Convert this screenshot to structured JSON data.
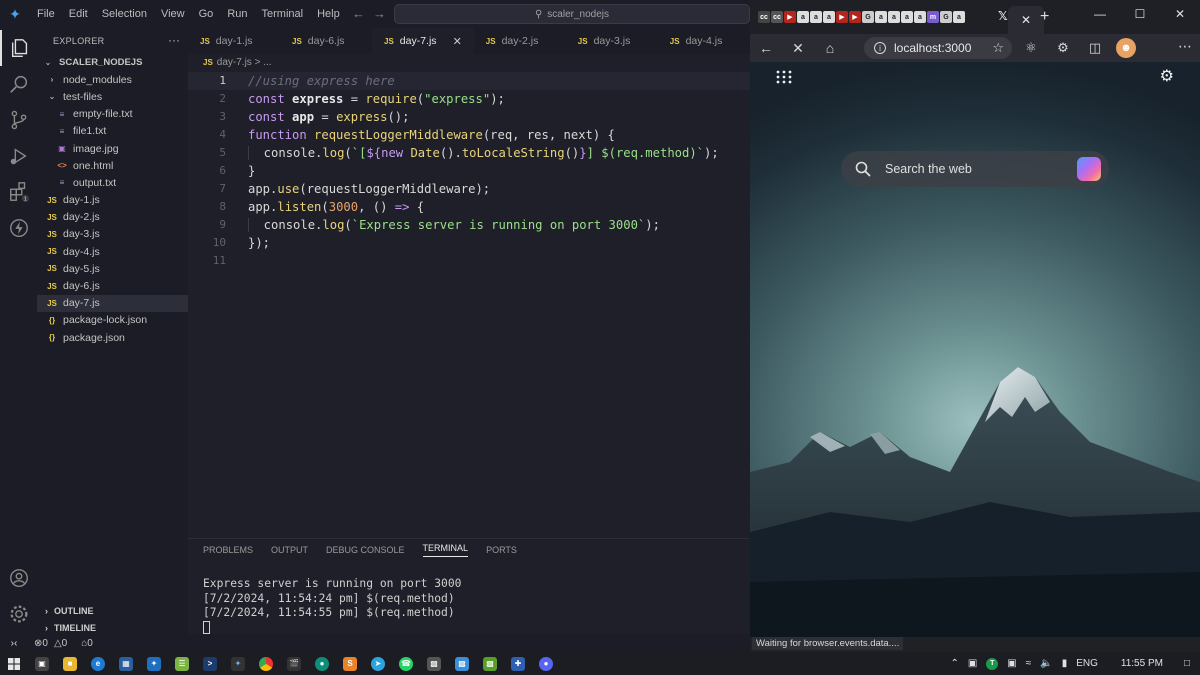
{
  "vscode": {
    "menu": [
      "File",
      "Edit",
      "Selection",
      "View",
      "Go",
      "Run",
      "Terminal",
      "Help"
    ],
    "command_center": "scaler_nodejs",
    "explorer": {
      "header": "EXPLORER",
      "root": "SCALER_NODEJS",
      "items": [
        {
          "label": "node_modules",
          "type": "folder-closed",
          "depth": 1
        },
        {
          "label": "test-files",
          "type": "folder-open",
          "depth": 1
        },
        {
          "label": "empty-file.txt",
          "type": "txt",
          "depth": 2
        },
        {
          "label": "file1.txt",
          "type": "txt",
          "depth": 2
        },
        {
          "label": "image.jpg",
          "type": "img",
          "depth": 2
        },
        {
          "label": "one.html",
          "type": "html",
          "depth": 2
        },
        {
          "label": "output.txt",
          "type": "txt",
          "depth": 2
        },
        {
          "label": "day-1.js",
          "type": "js",
          "depth": 1
        },
        {
          "label": "day-2.js",
          "type": "js",
          "depth": 1
        },
        {
          "label": "day-3.js",
          "type": "js",
          "depth": 1
        },
        {
          "label": "day-4.js",
          "type": "js",
          "depth": 1
        },
        {
          "label": "day-5.js",
          "type": "js",
          "depth": 1
        },
        {
          "label": "day-6.js",
          "type": "js",
          "depth": 1
        },
        {
          "label": "day-7.js",
          "type": "js",
          "depth": 1,
          "selected": true
        },
        {
          "label": "package-lock.json",
          "type": "json",
          "depth": 1
        },
        {
          "label": "package.json",
          "type": "json",
          "depth": 1
        }
      ],
      "outline": "OUTLINE",
      "timeline": "TIMELINE"
    },
    "tabs": [
      {
        "label": "day-1.js",
        "active": false
      },
      {
        "label": "day-6.js",
        "active": false
      },
      {
        "label": "day-7.js",
        "active": true
      },
      {
        "label": "day-2.js",
        "active": false
      },
      {
        "label": "day-3.js",
        "active": false
      },
      {
        "label": "day-4.js",
        "active": false
      }
    ],
    "breadcrumb": "day-7.js > ...",
    "panel_tabs": [
      "PROBLEMS",
      "OUTPUT",
      "DEBUG CONSOLE",
      "TERMINAL",
      "PORTS"
    ],
    "active_panel_tab": "TERMINAL",
    "terminal_lines": [
      "Express server is running on port 3000",
      "[7/2/2024, 11:54:24 pm] $(req.method)",
      "[7/2/2024, 11:54:55 pm] $(req.method)"
    ],
    "status": {
      "errors": "0",
      "warnings": "0",
      "ports": "0"
    }
  },
  "browser": {
    "address": "localhost:3000",
    "search_placeholder": "Search the web",
    "status_text": "Waiting for browser.events.data...."
  },
  "taskbar": {
    "language": "ENG",
    "time": "11:55 PM"
  },
  "colors": {
    "keyword": "#c79bf0",
    "string": "#9be08a",
    "function": "#e9d47a",
    "comment": "#6b6e80",
    "number": "#e8a46a",
    "js_icon": "#e6c94a"
  }
}
